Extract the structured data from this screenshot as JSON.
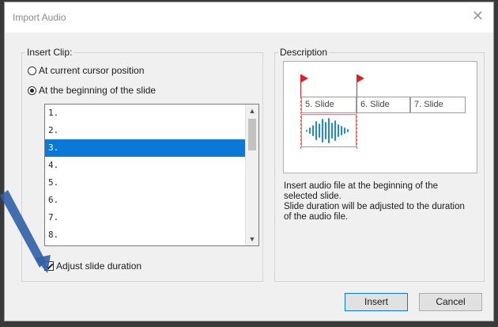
{
  "dialog": {
    "title": "Import Audio",
    "close_glyph": "✕"
  },
  "insert_clip": {
    "label": "Insert Clip:",
    "options": [
      {
        "label": "At current cursor position",
        "checked": false
      },
      {
        "label": "At the beginning of the slide",
        "checked": true
      }
    ],
    "slides": [
      "1.",
      "2.",
      "3.",
      "4.",
      "5.",
      "6.",
      "7.",
      "8."
    ],
    "selected_index": 2,
    "adjust_duration": {
      "label": "Adjust slide duration",
      "checked": true
    }
  },
  "description": {
    "label": "Description",
    "slides": [
      "5. Slide",
      "6. Slide",
      "7. Slide"
    ],
    "lines": [
      "Insert audio file at the beginning of the",
      "selected slide.",
      "Slide duration will be adjusted to the duration",
      "of the audio file."
    ]
  },
  "buttons": {
    "insert": "Insert",
    "cancel": "Cancel"
  },
  "colors": {
    "selection": "#0a78d7",
    "flag": "#e02020",
    "waveform": "#1e88e5",
    "annotation_arrow": "#2f5fa8"
  },
  "icons": {
    "close": "close-icon",
    "scroll_up": "chevron-up-icon",
    "scroll_down": "chevron-down-icon",
    "flag": "flag-icon",
    "waveform": "audio-waveform-icon"
  }
}
